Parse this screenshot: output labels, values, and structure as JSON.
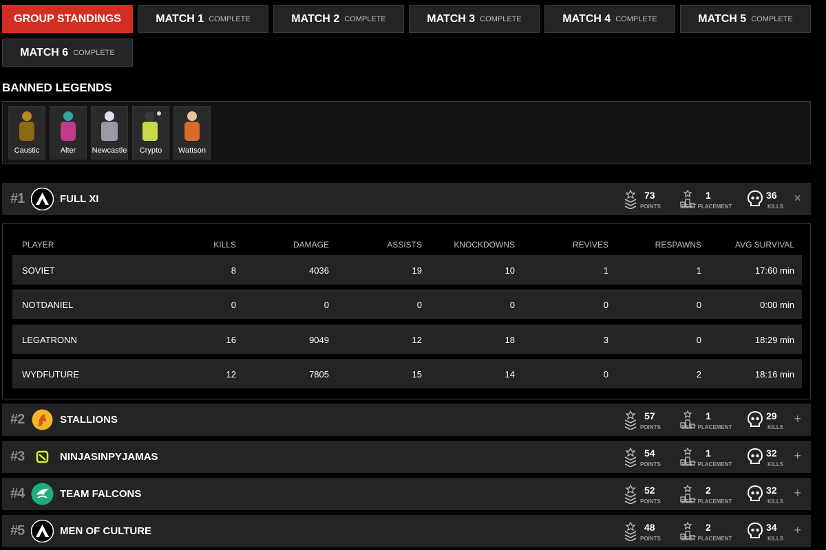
{
  "tabs": [
    {
      "main": "GROUP STANDINGS",
      "sub": "",
      "active": true
    },
    {
      "main": "MATCH 1",
      "sub": "COMPLETE"
    },
    {
      "main": "MATCH 2",
      "sub": "COMPLETE"
    },
    {
      "main": "MATCH 3",
      "sub": "COMPLETE"
    },
    {
      "main": "MATCH 4",
      "sub": "COMPLETE"
    },
    {
      "main": "MATCH 5",
      "sub": "COMPLETE"
    },
    {
      "main": "MATCH 6",
      "sub": "COMPLETE"
    }
  ],
  "banned": {
    "title": "BANNED LEGENDS",
    "legends": [
      {
        "name": "Caustic",
        "color": "#b58a1e"
      },
      {
        "name": "Alter",
        "color": "#c23a8c"
      },
      {
        "name": "Newcastle",
        "color": "#c8c8d0"
      },
      {
        "name": "Crypto",
        "color": "#c9d84a"
      },
      {
        "name": "Wattson",
        "color": "#d86a2a"
      }
    ]
  },
  "stat_labels": {
    "points": "POINTS",
    "best": "BEST PLACEMENT",
    "kills": "KILLS"
  },
  "teams": [
    {
      "rank": "#1",
      "name": "FULL XI",
      "points": "73",
      "best": "1",
      "kills": "36",
      "toggle": "×",
      "logo": "apex-logo-icon",
      "logo_color": "#000000"
    },
    {
      "rank": "#2",
      "name": "STALLIONS",
      "points": "57",
      "best": "1",
      "kills": "29",
      "toggle": "+",
      "logo": "stallion-logo-icon",
      "logo_color": "#f2b624"
    },
    {
      "rank": "#3",
      "name": "NINJASINPYJAMAS",
      "points": "54",
      "best": "1",
      "kills": "32",
      "toggle": "+",
      "logo": "nip-logo-icon",
      "logo_color": "#242424"
    },
    {
      "rank": "#4",
      "name": "TEAM FALCONS",
      "points": "52",
      "best": "2",
      "kills": "32",
      "toggle": "+",
      "logo": "falcon-logo-icon",
      "logo_color": "#1fae7a"
    },
    {
      "rank": "#5",
      "name": "MEN OF CULTURE",
      "points": "48",
      "best": "2",
      "kills": "34",
      "toggle": "+",
      "logo": "apex-logo-icon",
      "logo_color": "#000000"
    }
  ],
  "player_table": {
    "headers": [
      "PLAYER",
      "KILLS",
      "DAMAGE",
      "ASSISTS",
      "KNOCKDOWNS",
      "REVIVES",
      "RESPAWNS",
      "AVG SURVIVAL"
    ],
    "rows": [
      [
        "SOVIET",
        "8",
        "4036",
        "19",
        "10",
        "1",
        "1",
        "17:60 min"
      ],
      [
        "NOTDANIEL",
        "0",
        "0",
        "0",
        "0",
        "0",
        "0",
        "0:00 min"
      ],
      [
        "LEGATRONN",
        "16",
        "9049",
        "12",
        "18",
        "3",
        "0",
        "18:29 min"
      ],
      [
        "WYDFUTURE",
        "12",
        "7805",
        "15",
        "14",
        "0",
        "2",
        "18:16 min"
      ]
    ]
  },
  "colors": {
    "accent": "#d32e23",
    "panel": "#242424",
    "border": "#3a3a3a"
  }
}
